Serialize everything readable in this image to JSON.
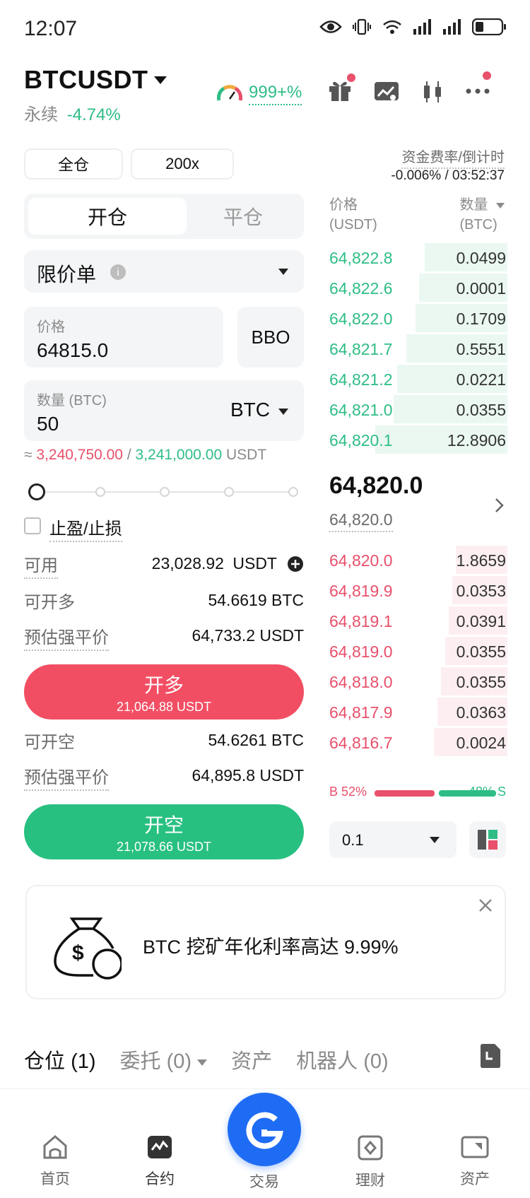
{
  "status_bar": {
    "time": "12:07"
  },
  "header": {
    "pair": "BTCUSDT",
    "contract_type": "永续",
    "change": "-4.74%",
    "ratio_badge": "999+%"
  },
  "settings": {
    "margin_mode": "全仓",
    "leverage": "200x",
    "funding_label": "资金费率/倒计时",
    "funding_value": "-0.006% / 03:52:37"
  },
  "tabs": {
    "open": "开仓",
    "close": "平仓"
  },
  "order_form": {
    "order_type": "限价单",
    "price_label": "价格",
    "price_value": "64815.0",
    "bbo_label": "BBO",
    "qty_label": "数量 (BTC)",
    "qty_value": "50",
    "qty_unit": "BTC",
    "approx_prefix": "≈",
    "approx_long": "3,240,750.00",
    "approx_sep": "/",
    "approx_short": "3,241,000.00",
    "approx_unit": "USDT",
    "tpsl_label": "止盈/止损"
  },
  "account": {
    "available_label": "可用",
    "available_value": "23,028.92",
    "available_unit": "USDT",
    "can_long_label": "可开多",
    "can_long_value": "54.6619 BTC",
    "liq_label": "预估强平价",
    "liq_long_value": "64,733.2 USDT",
    "can_short_label": "可开空",
    "can_short_value": "54.6261 BTC",
    "liq_short_value": "64,895.8 USDT"
  },
  "long_button": {
    "label": "开多",
    "amount": "21,064.88 USDT"
  },
  "short_button": {
    "label": "开空",
    "amount": "21,078.66 USDT"
  },
  "orderbook": {
    "price_header": "价格",
    "price_unit": "(USDT)",
    "qty_header": "数量",
    "qty_unit": "(BTC)",
    "asks": [
      {
        "price": "64,822.8",
        "qty": "0.0499",
        "depth": 0.45
      },
      {
        "price": "64,822.6",
        "qty": "0.0001",
        "depth": 0.48
      },
      {
        "price": "64,822.0",
        "qty": "0.1709",
        "depth": 0.5
      },
      {
        "price": "64,821.7",
        "qty": "0.5551",
        "depth": 0.55
      },
      {
        "price": "64,821.2",
        "qty": "0.0221",
        "depth": 0.6
      },
      {
        "price": "64,821.0",
        "qty": "0.0355",
        "depth": 0.62
      },
      {
        "price": "64,820.1",
        "qty": "12.8906",
        "depth": 0.72
      }
    ],
    "mid_price": "64,820.0",
    "mark_price": "64,820.0",
    "bids": [
      {
        "price": "64,820.0",
        "qty": "1.8659",
        "depth": 0.28
      },
      {
        "price": "64,819.9",
        "qty": "0.0353",
        "depth": 0.3
      },
      {
        "price": "64,819.1",
        "qty": "0.0391",
        "depth": 0.32
      },
      {
        "price": "64,819.0",
        "qty": "0.0355",
        "depth": 0.34
      },
      {
        "price": "64,818.0",
        "qty": "0.0355",
        "depth": 0.36
      },
      {
        "price": "64,817.9",
        "qty": "0.0363",
        "depth": 0.38
      },
      {
        "price": "64,816.7",
        "qty": "0.0024",
        "depth": 0.4
      }
    ],
    "buy_ratio": "B 52%",
    "sell_ratio": "48% S",
    "buy_ratio_value": 0.52,
    "depth_step": "0.1"
  },
  "promo": {
    "text": "BTC 挖矿年化利率高达 9.99%"
  },
  "position_tabs": [
    {
      "label": "仓位",
      "count": "(1)"
    },
    {
      "label": "委托",
      "count": "(0)"
    },
    {
      "label": "资产",
      "count": ""
    },
    {
      "label": "机器人",
      "count": "(0)"
    }
  ],
  "nav": {
    "home": "首页",
    "futures": "合约",
    "trade": "交易",
    "earn": "理财",
    "assets": "资产"
  },
  "colors": {
    "green": "#2ebd85",
    "red": "#e8506b",
    "brand": "#1f6cf4"
  }
}
